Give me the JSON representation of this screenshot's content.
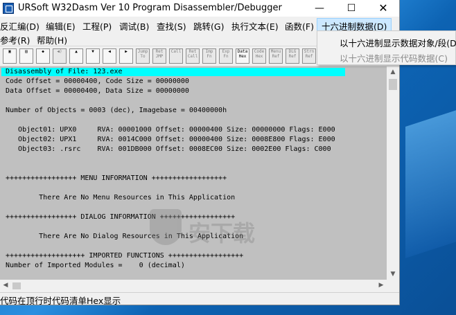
{
  "window": {
    "title": "URSoft W32Dasm Ver 10   Program Disassembler/Debugger",
    "controls": {
      "minimize": "—",
      "maximize": "☐",
      "close": "✕"
    }
  },
  "menus": {
    "row1": [
      "反汇编(D)",
      "编辑(E)",
      "工程(P)",
      "调试(B)",
      "查找(S)",
      "跳转(G)",
      "执行文本(E)",
      "函数(F)",
      "十六进制数据(D)"
    ],
    "row2": [
      "参考(R)",
      "帮助(H)"
    ]
  },
  "dropdown": {
    "items": [
      "以十六进制显示数据对象/段(D)",
      "以十六进制显示代码数据(C)"
    ]
  },
  "toolbar": {
    "buttons": [
      "",
      "",
      "",
      "",
      "",
      "",
      "",
      "",
      "Jump To",
      "Ret JMP",
      "Call",
      "Ret Call",
      "Imp Fn",
      "Exp Fn",
      "Data Hex",
      "Code Hex",
      "Menu Ref",
      "DLG Ref",
      "Strn Ref"
    ]
  },
  "disassembly": {
    "lines": [
      "Disassembly of File: 123.exe",
      "Code Offset = 00000400, Code Size = 00000000",
      "Data Offset = 00000400, Data Size = 00000000",
      "",
      "Number of Objects = 0003 (dec), Imagebase = 00400000h",
      "",
      "   Object01: UPX0     RVA: 00001000 Offset: 00000400 Size: 00000000 Flags: E000",
      "   Object02: UPX1     RVA: 0014C000 Offset: 00000400 Size: 0008E800 Flags: E000",
      "   Object03: .rsrc    RVA: 001DB000 Offset: 0008EC00 Size: 0002E00 Flags: C000",
      "",
      "",
      "",
      "+++++++++++++++++ MENU INFORMATION ++++++++++++++++++",
      "",
      "        There Are No Menu Resources in This Application",
      "",
      "+++++++++++++++++ DIALOG INFORMATION ++++++++++++++++++",
      "",
      "        There Are No Dialog Resources in This Application",
      "",
      "+++++++++++++++++++ IMPORTED FUNCTIONS ++++++++++++++++++",
      "Number of Imported Modules =    0 (decimal)"
    ]
  },
  "status": {
    "text": "代码在顶行时代码清单Hex显示"
  },
  "watermark": {
    "text": "安下载"
  }
}
